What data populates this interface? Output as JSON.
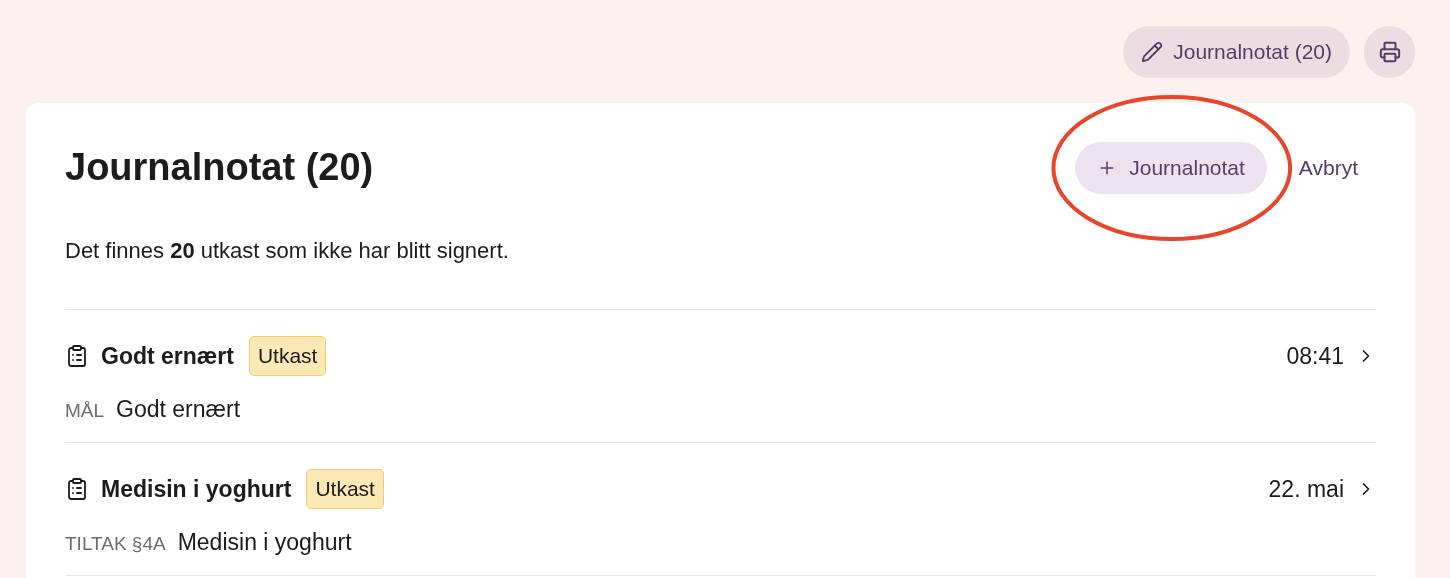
{
  "toolbar": {
    "journal_button": "Journalnotat (20)"
  },
  "card": {
    "title": "Journalnotat (20)",
    "add_button": "Journalnotat",
    "cancel_link": "Avbryt",
    "summary": "Det finnes **20** utkast som ikke har blitt signert.",
    "entries": [
      {
        "title": "Godt ernært",
        "badge": "Utkast",
        "time": "08:41",
        "category": "MÅL",
        "text": "Godt ernært"
      },
      {
        "title": "Medisin i yoghurt",
        "badge": "Utkast",
        "time": "22. mai",
        "category": "TILTAK §4A",
        "text": "Medisin i yoghurt"
      }
    ]
  }
}
